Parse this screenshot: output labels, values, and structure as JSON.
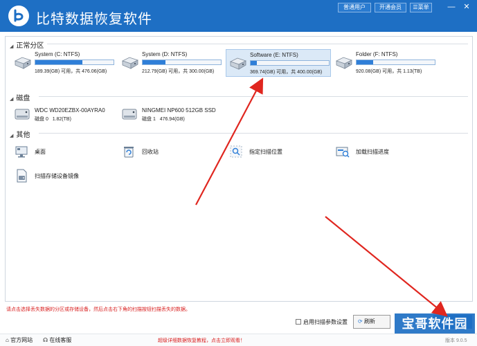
{
  "window": {
    "title": "比特数据恢复软件",
    "buttons": {
      "normal_user": "普通用户",
      "open_member": "开通会员",
      "menu": "菜单"
    },
    "controls": {
      "minimize": "—",
      "close": "✕"
    }
  },
  "sections": {
    "partitions": {
      "title": "正常分区"
    },
    "disks": {
      "title": "磁盘"
    },
    "others": {
      "title": "其他"
    }
  },
  "partitions": [
    {
      "name": "System (C: NTFS)",
      "info": "189.39(GB) 可用，共 476.06(GB)",
      "used_fraction": 0.6,
      "selected": false
    },
    {
      "name": "System (D: NTFS)",
      "info": "212.79(GB) 可用，共 300.00(GB)",
      "used_fraction": 0.29,
      "selected": false
    },
    {
      "name": "Software (E: NTFS)",
      "info": "369.74(GB) 可用，共 400.00(GB)",
      "used_fraction": 0.08,
      "selected": true
    },
    {
      "name": "Folder (F: NTFS)",
      "info": "920.08(GB) 可用，共 1.13(TB)",
      "used_fraction": 0.21,
      "selected": false
    }
  ],
  "disks": [
    {
      "name": "WDC WD20EZBX-00AYRA0",
      "index": "磁盘 0",
      "size": "1.82(TB)"
    },
    {
      "name": "NINGMEI NP600 512GB SSD",
      "index": "磁盘 1",
      "size": "476.94(GB)"
    }
  ],
  "others": [
    {
      "label": "桌面",
      "icon": "desktop-icon"
    },
    {
      "label": "回收站",
      "icon": "recycle-bin-icon"
    },
    {
      "label": "指定扫描位置",
      "icon": "scan-location-icon"
    },
    {
      "label": "加载扫描进度",
      "icon": "load-progress-icon"
    },
    {
      "label": "扫描存储设备镜像",
      "icon": "disk-image-icon"
    }
  ],
  "bottom": {
    "hint": "请点击选择丢失数据的分区或存储设备，然后点击右下角的扫描按钮扫描丢失的数据。",
    "enable_scan_params": "启用扫描参数设置",
    "refresh": "刷新",
    "scan": "扫描"
  },
  "footer": {
    "website": "官方网站",
    "support": "在线客服",
    "promo": "超级详细数据恢复教程，点击立即观看！",
    "version": "版本 9.0.5"
  },
  "watermark": "宝哥软件园",
  "colors": {
    "brand": "#1e6fc4",
    "bar": "#2f7fd8",
    "selected_bg": "#dbe9f7",
    "hint_red": "#d92020",
    "arrow_red": "#e0261f"
  }
}
